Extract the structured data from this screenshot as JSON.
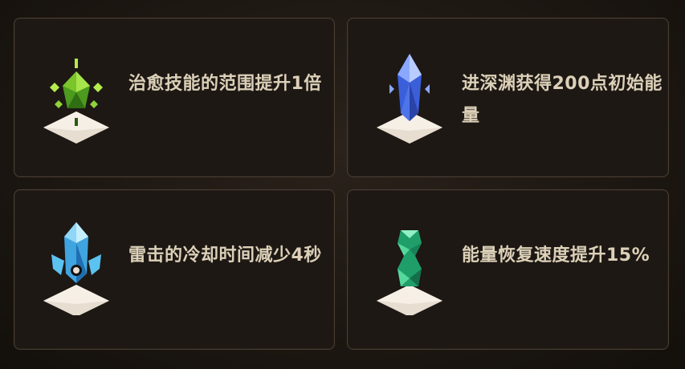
{
  "cards": [
    {
      "icon": "green-healing-crystal-icon",
      "accent": "#8fd33a",
      "text": "治愈技能的范围提升1倍"
    },
    {
      "icon": "blue-abyss-crystal-icon",
      "accent": "#5f8dff",
      "text": "进深渊获得200点初始能量"
    },
    {
      "icon": "ice-lightning-crystal-icon",
      "accent": "#5cc2f0",
      "text": "雷击的冷却时间减少4秒"
    },
    {
      "icon": "emerald-energy-crystal-icon",
      "accent": "#2fc58a",
      "text": "能量恢复速度提升15%"
    }
  ]
}
